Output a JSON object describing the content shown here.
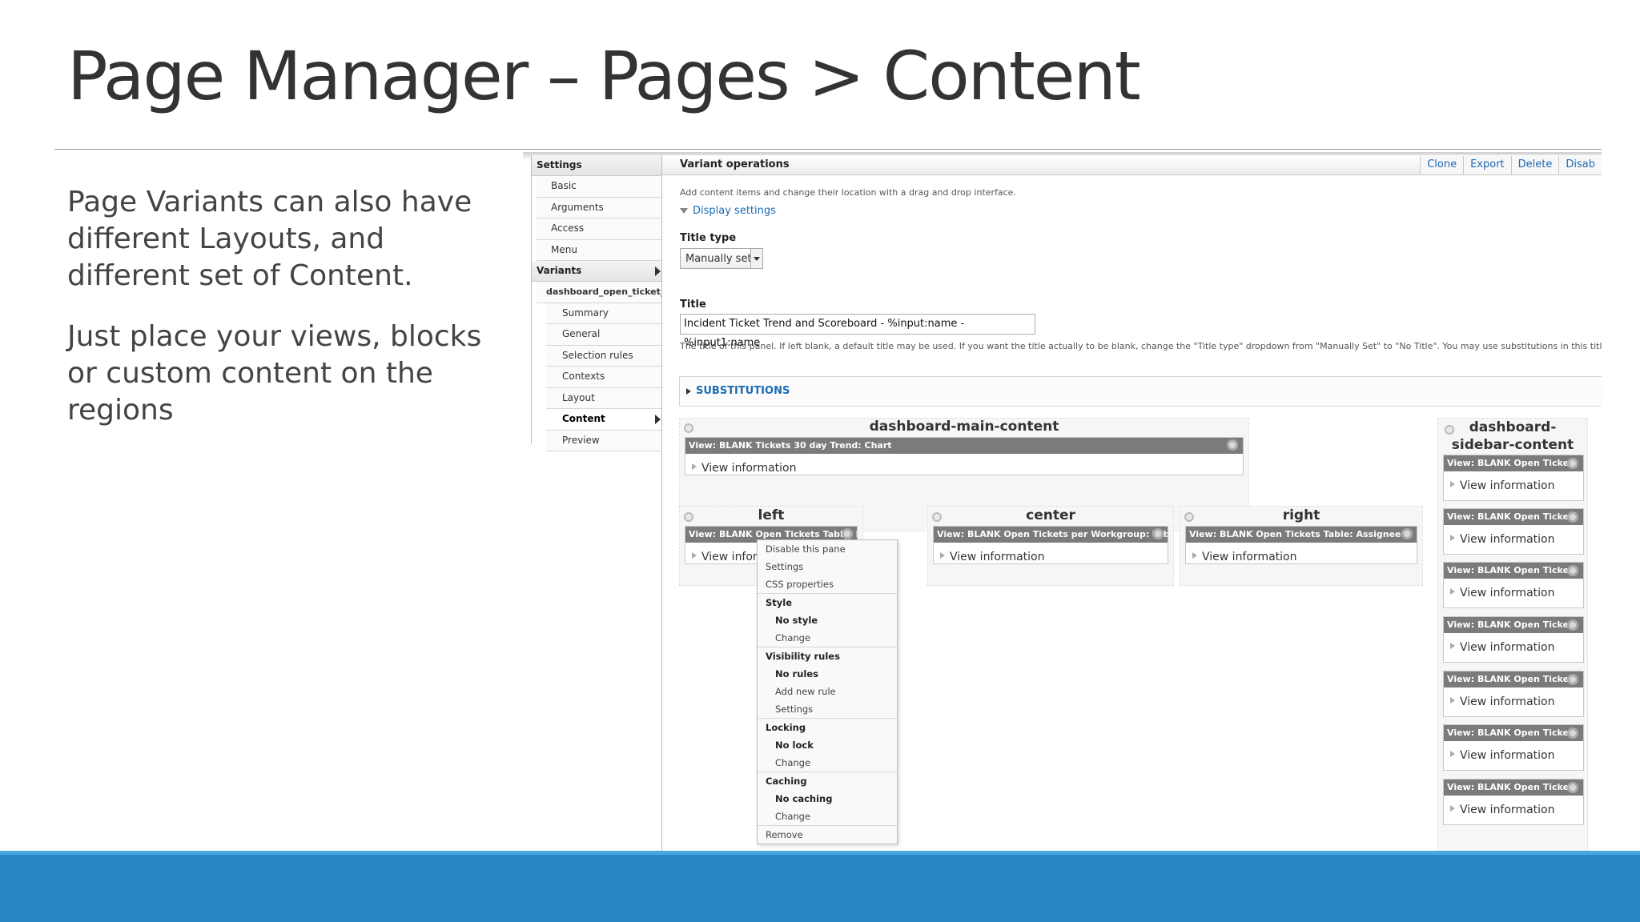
{
  "slide": {
    "title": "Page Manager – Pages > Content",
    "paragraph1": "Page Variants can also have different Layouts, and different set of Content.",
    "paragraph2": "Just place your views, blocks or custom content on the regions"
  },
  "nav": {
    "settings_label": "Settings",
    "settings_items": [
      "Basic",
      "Arguments",
      "Access",
      "Menu"
    ],
    "variants_label": "Variants",
    "variant_name": "dashboard_open_ticket_ti",
    "variant_items": [
      "Summary",
      "General",
      "Selection rules",
      "Contexts",
      "Layout",
      "Content",
      "Preview"
    ],
    "active_item": "Content"
  },
  "header": {
    "title": "Variant operations",
    "actions": [
      "Clone",
      "Export",
      "Delete",
      "Disab"
    ]
  },
  "form": {
    "description": "Add content items and change their location with a drag and drop interface.",
    "display_settings": "Display settings",
    "title_type_label": "Title type",
    "title_type_value": "Manually set",
    "title_label": "Title",
    "title_value": "Incident Ticket Trend and Scoreboard - %input:name - %input1:name",
    "title_help": "The title of this panel. If left blank, a default title may be used. If you want the title actually to be blank, change the \"Title type\" dropdown from \"Manually Set\" to \"No Title\". You may use substitutions in this title.",
    "substitutions": "SUBSTITUTIONS"
  },
  "regions": {
    "main": {
      "title": "dashboard-main-content",
      "pane": {
        "head": "View: BLANK Tickets 30 day Trend: Chart",
        "body": "View information"
      }
    },
    "left": {
      "title": "left",
      "pane": {
        "head": "View: BLANK Open Tickets Table: Page",
        "body": "View infor"
      }
    },
    "center": {
      "title": "center",
      "pane": {
        "head": "View: BLANK Open Tickets per Workgroup: Table",
        "body": "View information"
      }
    },
    "right": {
      "title": "right",
      "pane": {
        "head": "View: BLANK Open Tickets Table: Assignee",
        "body": "View information"
      }
    },
    "sidebar": {
      "title_line1": "dashboard-",
      "title_line2": "sidebar-content",
      "panes": [
        {
          "head": "View: BLANK Open Ticket",
          "body": "View information"
        },
        {
          "head": "View: BLANK Open Ticket",
          "body": "View information"
        },
        {
          "head": "View: BLANK Open Ticket",
          "body": "View information"
        },
        {
          "head": "View: BLANK Open Ticket",
          "body": "View information"
        },
        {
          "head": "View: BLANK Open Ticket",
          "body": "View information"
        },
        {
          "head": "View: BLANK Open Ticket",
          "body": "View information"
        },
        {
          "head": "View: BLANK Open Ticket",
          "body": "View information"
        }
      ]
    }
  },
  "pane_menu": {
    "items": [
      {
        "label": "Disable this pane",
        "type": "item"
      },
      {
        "label": "Settings",
        "type": "item"
      },
      {
        "label": "CSS properties",
        "type": "item"
      },
      {
        "label": "Style",
        "type": "header"
      },
      {
        "label": "No style",
        "type": "value"
      },
      {
        "label": "Change",
        "type": "sub"
      },
      {
        "label": "Visibility rules",
        "type": "header"
      },
      {
        "label": "No rules",
        "type": "value"
      },
      {
        "label": "Add new rule",
        "type": "sub"
      },
      {
        "label": "Settings",
        "type": "sub"
      },
      {
        "label": "Locking",
        "type": "header"
      },
      {
        "label": "No lock",
        "type": "value"
      },
      {
        "label": "Change",
        "type": "sub"
      },
      {
        "label": "Caching",
        "type": "header"
      },
      {
        "label": "No caching",
        "type": "value"
      },
      {
        "label": "Change",
        "type": "sub"
      },
      {
        "label": "Remove",
        "type": "footer"
      }
    ]
  },
  "colors": {
    "link": "#1d6bb5",
    "pane_header": "#7b7b7b",
    "footer_band": "#2a87c7"
  }
}
